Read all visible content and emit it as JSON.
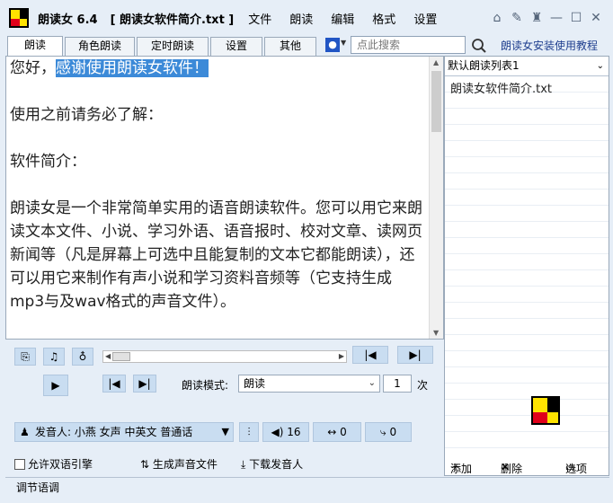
{
  "app": {
    "title": "朗读女 6.4",
    "document": "[ 朗读女软件简介.txt ]",
    "colors": {
      "accent": "#3c8ad8",
      "button_bg": "#c9ddf1",
      "logo_yellow": "#ffe300",
      "logo_red": "#e0001a"
    }
  },
  "menu": [
    "文件",
    "朗读",
    "编辑",
    "格式",
    "设置"
  ],
  "window_controls": {
    "home": "⌂",
    "pin": "✎",
    "shirt": "♜",
    "minimize": "—",
    "maximize": "☐",
    "close": "✕"
  },
  "tabs": [
    "朗读",
    "角色朗读",
    "定时朗读",
    "设置",
    "其他"
  ],
  "search": {
    "placeholder": "点此搜索",
    "value": ""
  },
  "install_link": "朗读女安装使用教程",
  "text": {
    "greeting": "您好，",
    "selected": "感谢使用朗读女软件！",
    "line2": "使用之前请务必了解：",
    "line3": "软件简介：",
    "paragraph": "朗读女是一个非常简单实用的语音朗读软件。您可以用它来朗读文本文件、小说、学习外语、语音报时、校对文章、读网页新闻等（凡是屏幕上可选中且能复制的文本它都能朗读），还可以用它来制作有声小说和学习资料音频等（它支持生成mp3与及wav格式的声音文件）。"
  },
  "playback": {
    "mode_label": "朗读模式:",
    "mode_value": "朗读",
    "count_value": "1",
    "count_unit": "次"
  },
  "voice": {
    "label": "发音人: 小燕 女声 中英文 普通话",
    "volume": "16",
    "speed": "0",
    "pitch": "0"
  },
  "options": {
    "bilingual": "允许双语引擎",
    "generate": "生成声音文件",
    "download": "下载发音人"
  },
  "playlist": {
    "selected_list": "默认朗读列表1",
    "items": [
      "朗读女软件简介.txt"
    ],
    "add": "添加",
    "delete": "删除",
    "options": "选项"
  },
  "status": "调节语调"
}
